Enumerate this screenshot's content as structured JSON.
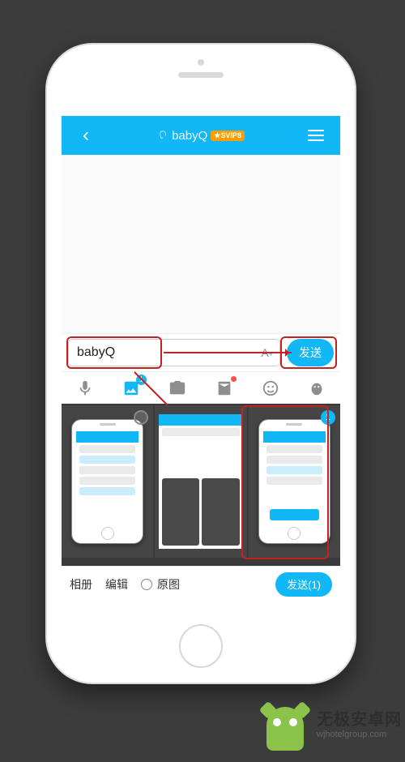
{
  "header": {
    "title": "babyQ",
    "vip_badge": "★SVIP8"
  },
  "input": {
    "value": "babyQ",
    "font_toggle": "A",
    "send_label": "发送"
  },
  "tabs": {
    "image_badge": "1"
  },
  "picker": {
    "selected_index_label": "1"
  },
  "options": {
    "album": "相册",
    "edit": "编辑",
    "original": "原图",
    "send_label": "发送(1)"
  },
  "watermark": {
    "name_cn": "无极安卓网",
    "name_en": "wjhotelgroup.com"
  },
  "colors": {
    "accent": "#12b7f5",
    "highlight": "#c62121",
    "vip": "#ff9c00"
  }
}
